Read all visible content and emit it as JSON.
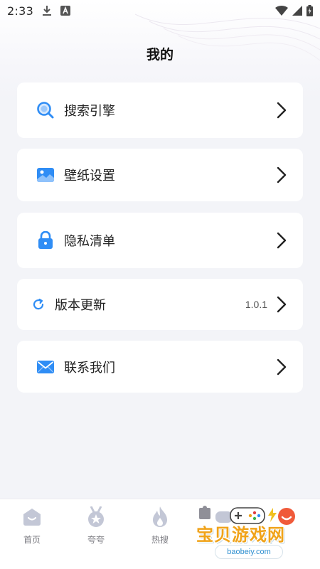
{
  "status_bar": {
    "time": "2:33",
    "icons": [
      "download-icon",
      "a-app-icon",
      "wifi-icon",
      "signal-icon",
      "battery-icon"
    ]
  },
  "header": {
    "title": "我的"
  },
  "menu": {
    "items": [
      {
        "label": "搜索引擎",
        "icon": "search-icon",
        "value": ""
      },
      {
        "label": "壁纸设置",
        "icon": "image-icon",
        "value": ""
      },
      {
        "label": "隐私清单",
        "icon": "lock-icon",
        "value": ""
      },
      {
        "label": "版本更新",
        "icon": "refresh-icon",
        "value": "1.0.1"
      },
      {
        "label": "联系我们",
        "icon": "mail-icon",
        "value": ""
      }
    ]
  },
  "tabbar": {
    "tabs": [
      {
        "label": "首页",
        "icon": "home-icon"
      },
      {
        "label": "夸夸",
        "icon": "medal-icon"
      },
      {
        "label": "热搜",
        "icon": "flame-icon"
      },
      {
        "label": "",
        "icon": "game-icon"
      },
      {
        "label": "",
        "icon": "profile-icon"
      }
    ]
  },
  "watermark": {
    "text": "宝贝游戏网",
    "url": "baobeiy.com"
  },
  "colors": {
    "accent": "#2f8df5",
    "card_bg": "#ffffff",
    "page_bg": "#f3f4f8",
    "tab_icon": "#c3c7d6",
    "profile_active": "#f05a3a"
  }
}
